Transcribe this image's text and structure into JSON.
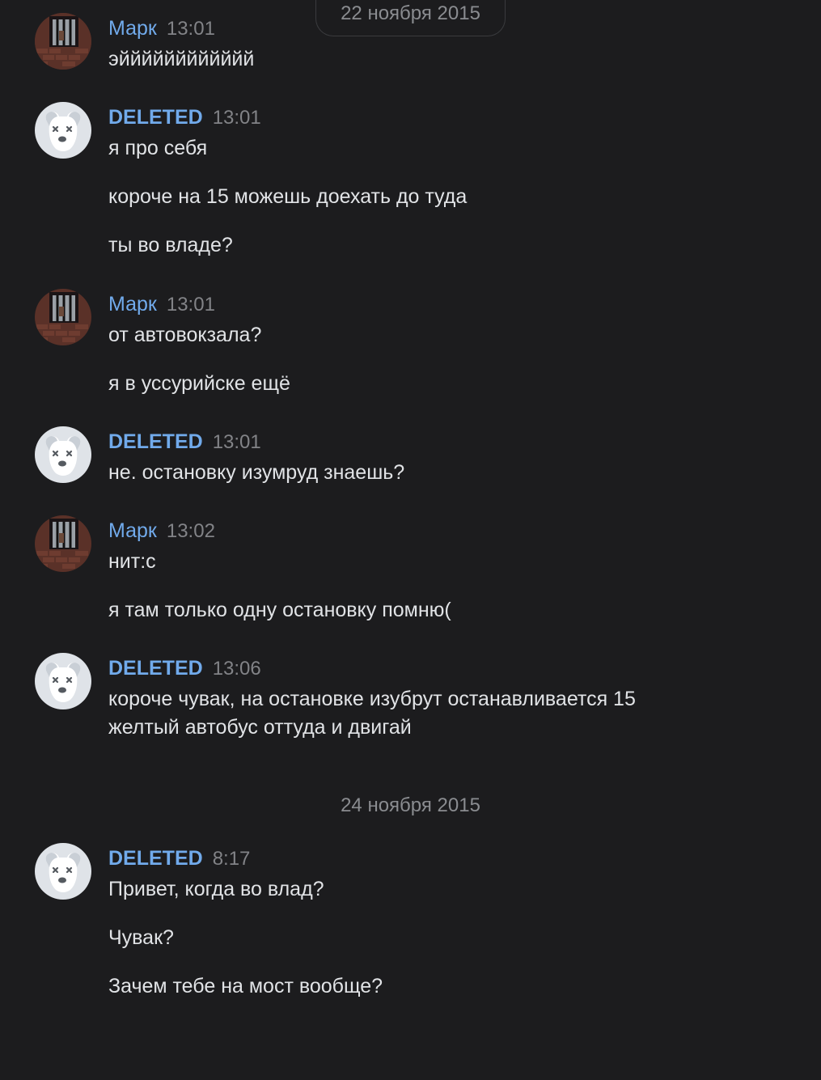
{
  "dates": {
    "first": "22 ноября 2015",
    "second": "24 ноября 2015"
  },
  "messages": [
    {
      "author": "Марк",
      "time": "13:01",
      "lines": [
        "эйййййййййййй"
      ]
    },
    {
      "author": "DELETED",
      "time": "13:01",
      "lines": [
        "я про себя",
        "короче на 15 можешь доехать до туда",
        "ты во владе?"
      ]
    },
    {
      "author": "Марк",
      "time": "13:01",
      "lines": [
        "от автовокзала?",
        "я в уссурийске ещё"
      ]
    },
    {
      "author": "DELETED",
      "time": "13:01",
      "lines": [
        "не. остановку изумруд знаешь?"
      ]
    },
    {
      "author": "Марк",
      "time": "13:02",
      "lines": [
        "нит:с",
        "я там только одну остановку помню("
      ]
    },
    {
      "author": "DELETED",
      "time": "13:06",
      "lines": [
        "короче чувак, на остановке изубрут останавливается 15",
        "желтый автобус оттуда и двигай"
      ]
    },
    {
      "author": "DELETED",
      "time": "8:17",
      "lines": [
        "Привет, когда во влад?",
        "Чувак?",
        "Зачем тебе на мост вообще?"
      ]
    }
  ],
  "colors": {
    "background": "#1c1c1e",
    "author": "#71aaeb",
    "text": "#e1e3e6",
    "meta": "#828387"
  },
  "icons": {
    "mark_avatar": "user-photo-avatar",
    "deleted_avatar": "deleted-dog-avatar"
  }
}
